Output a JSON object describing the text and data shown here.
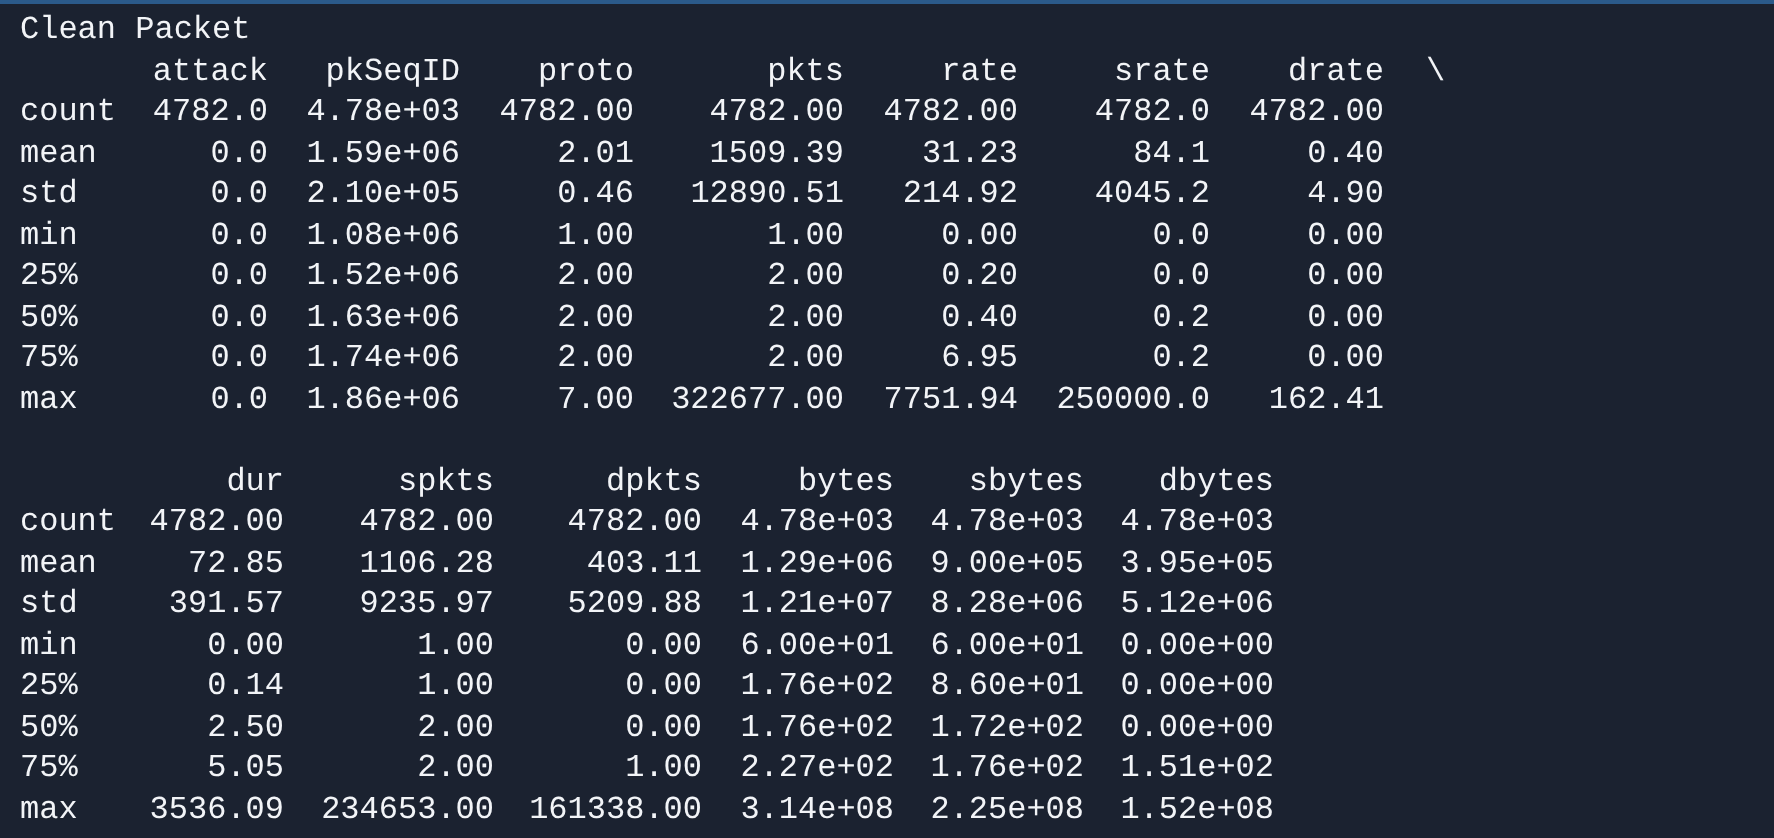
{
  "title": "Clean Packet",
  "tables": [
    {
      "columns": [
        "attack",
        "pkSeqID",
        "proto",
        "pkts",
        "rate",
        "srate",
        "drate"
      ],
      "continuation": "\\",
      "rows": [
        {
          "label": "count",
          "values": [
            "4782.0",
            "4.78e+03",
            "4782.00",
            "4782.00",
            "4782.00",
            "4782.0",
            "4782.00"
          ]
        },
        {
          "label": "mean",
          "values": [
            "0.0",
            "1.59e+06",
            "2.01",
            "1509.39",
            "31.23",
            "84.1",
            "0.40"
          ]
        },
        {
          "label": "std",
          "values": [
            "0.0",
            "2.10e+05",
            "0.46",
            "12890.51",
            "214.92",
            "4045.2",
            "4.90"
          ]
        },
        {
          "label": "min",
          "values": [
            "0.0",
            "1.08e+06",
            "1.00",
            "1.00",
            "0.00",
            "0.0",
            "0.00"
          ]
        },
        {
          "label": "25%",
          "values": [
            "0.0",
            "1.52e+06",
            "2.00",
            "2.00",
            "0.20",
            "0.0",
            "0.00"
          ]
        },
        {
          "label": "50%",
          "values": [
            "0.0",
            "1.63e+06",
            "2.00",
            "2.00",
            "0.40",
            "0.2",
            "0.00"
          ]
        },
        {
          "label": "75%",
          "values": [
            "0.0",
            "1.74e+06",
            "2.00",
            "2.00",
            "6.95",
            "0.2",
            "0.00"
          ]
        },
        {
          "label": "max",
          "values": [
            "0.0",
            "1.86e+06",
            "7.00",
            "322677.00",
            "7751.94",
            "250000.0",
            "162.41"
          ]
        }
      ]
    },
    {
      "columns": [
        "dur",
        "spkts",
        "dpkts",
        "bytes",
        "sbytes",
        "dbytes"
      ],
      "rows": [
        {
          "label": "count",
          "values": [
            "4782.00",
            "4782.00",
            "4782.00",
            "4.78e+03",
            "4.78e+03",
            "4.78e+03"
          ]
        },
        {
          "label": "mean",
          "values": [
            "72.85",
            "1106.28",
            "403.11",
            "1.29e+06",
            "9.00e+05",
            "3.95e+05"
          ]
        },
        {
          "label": "std",
          "values": [
            "391.57",
            "9235.97",
            "5209.88",
            "1.21e+07",
            "8.28e+06",
            "5.12e+06"
          ]
        },
        {
          "label": "min",
          "values": [
            "0.00",
            "1.00",
            "0.00",
            "6.00e+01",
            "6.00e+01",
            "0.00e+00"
          ]
        },
        {
          "label": "25%",
          "values": [
            "0.14",
            "1.00",
            "0.00",
            "1.76e+02",
            "8.60e+01",
            "0.00e+00"
          ]
        },
        {
          "label": "50%",
          "values": [
            "2.50",
            "2.00",
            "0.00",
            "1.76e+02",
            "1.72e+02",
            "0.00e+00"
          ]
        },
        {
          "label": "75%",
          "values": [
            "5.05",
            "2.00",
            "1.00",
            "2.27e+02",
            "1.76e+02",
            "1.51e+02"
          ]
        },
        {
          "label": "max",
          "values": [
            "3536.09",
            "234653.00",
            "161338.00",
            "3.14e+08",
            "2.25e+08",
            "1.52e+08"
          ]
        }
      ]
    }
  ]
}
